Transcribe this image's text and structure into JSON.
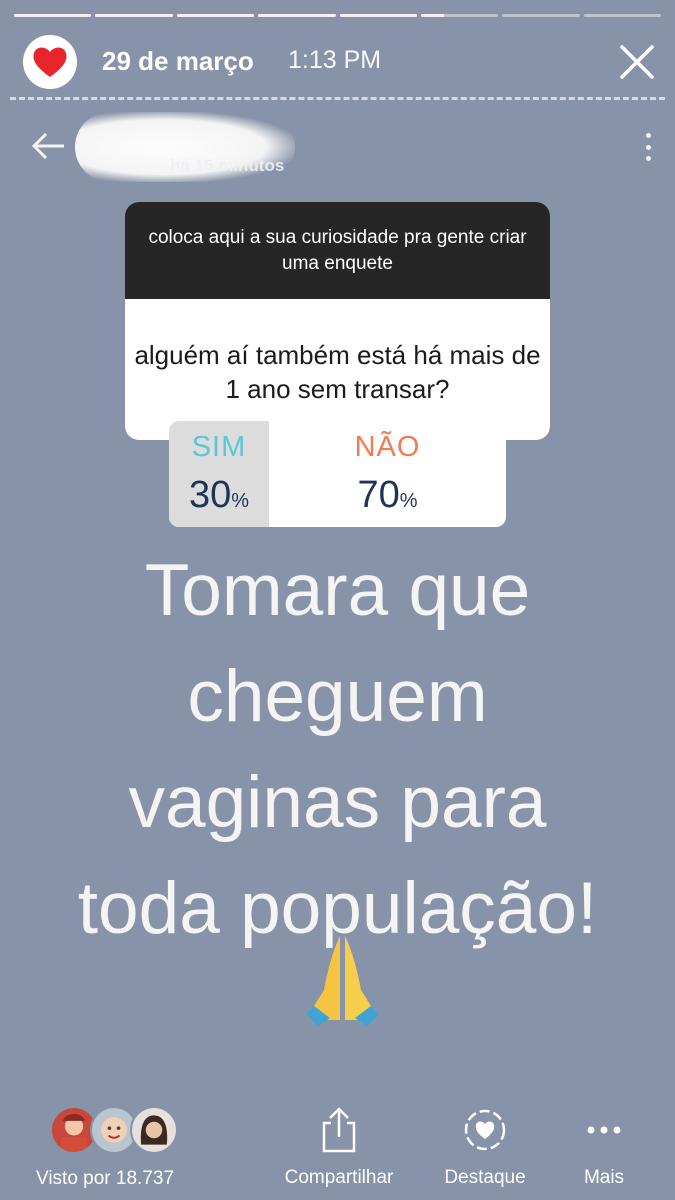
{
  "story": {
    "progress_segments": [
      1,
      1,
      1,
      1,
      1,
      0.3,
      0,
      0
    ],
    "date": "29 de março",
    "time": "1:13 PM"
  },
  "inner_post": {
    "time_ago": "há 15 minutos"
  },
  "question": {
    "prompt": "coloca aqui a sua curiosidade pra gente criar uma enquete",
    "text": "alguém aí também está há mais de 1 ano sem transar?"
  },
  "poll": {
    "options": [
      {
        "label": "SIM",
        "value": "30",
        "unit": "%"
      },
      {
        "label": "NÃO",
        "value": "70",
        "unit": "%"
      }
    ]
  },
  "caption": {
    "lines": [
      "Tomara que",
      "cheguem",
      "vaginas para",
      "toda população!"
    ],
    "emoji": "folded-hands"
  },
  "footer": {
    "seen_by": "Visto por 18.737",
    "share": "Compartilhar",
    "highlight": "Destaque",
    "more": "Mais"
  }
}
